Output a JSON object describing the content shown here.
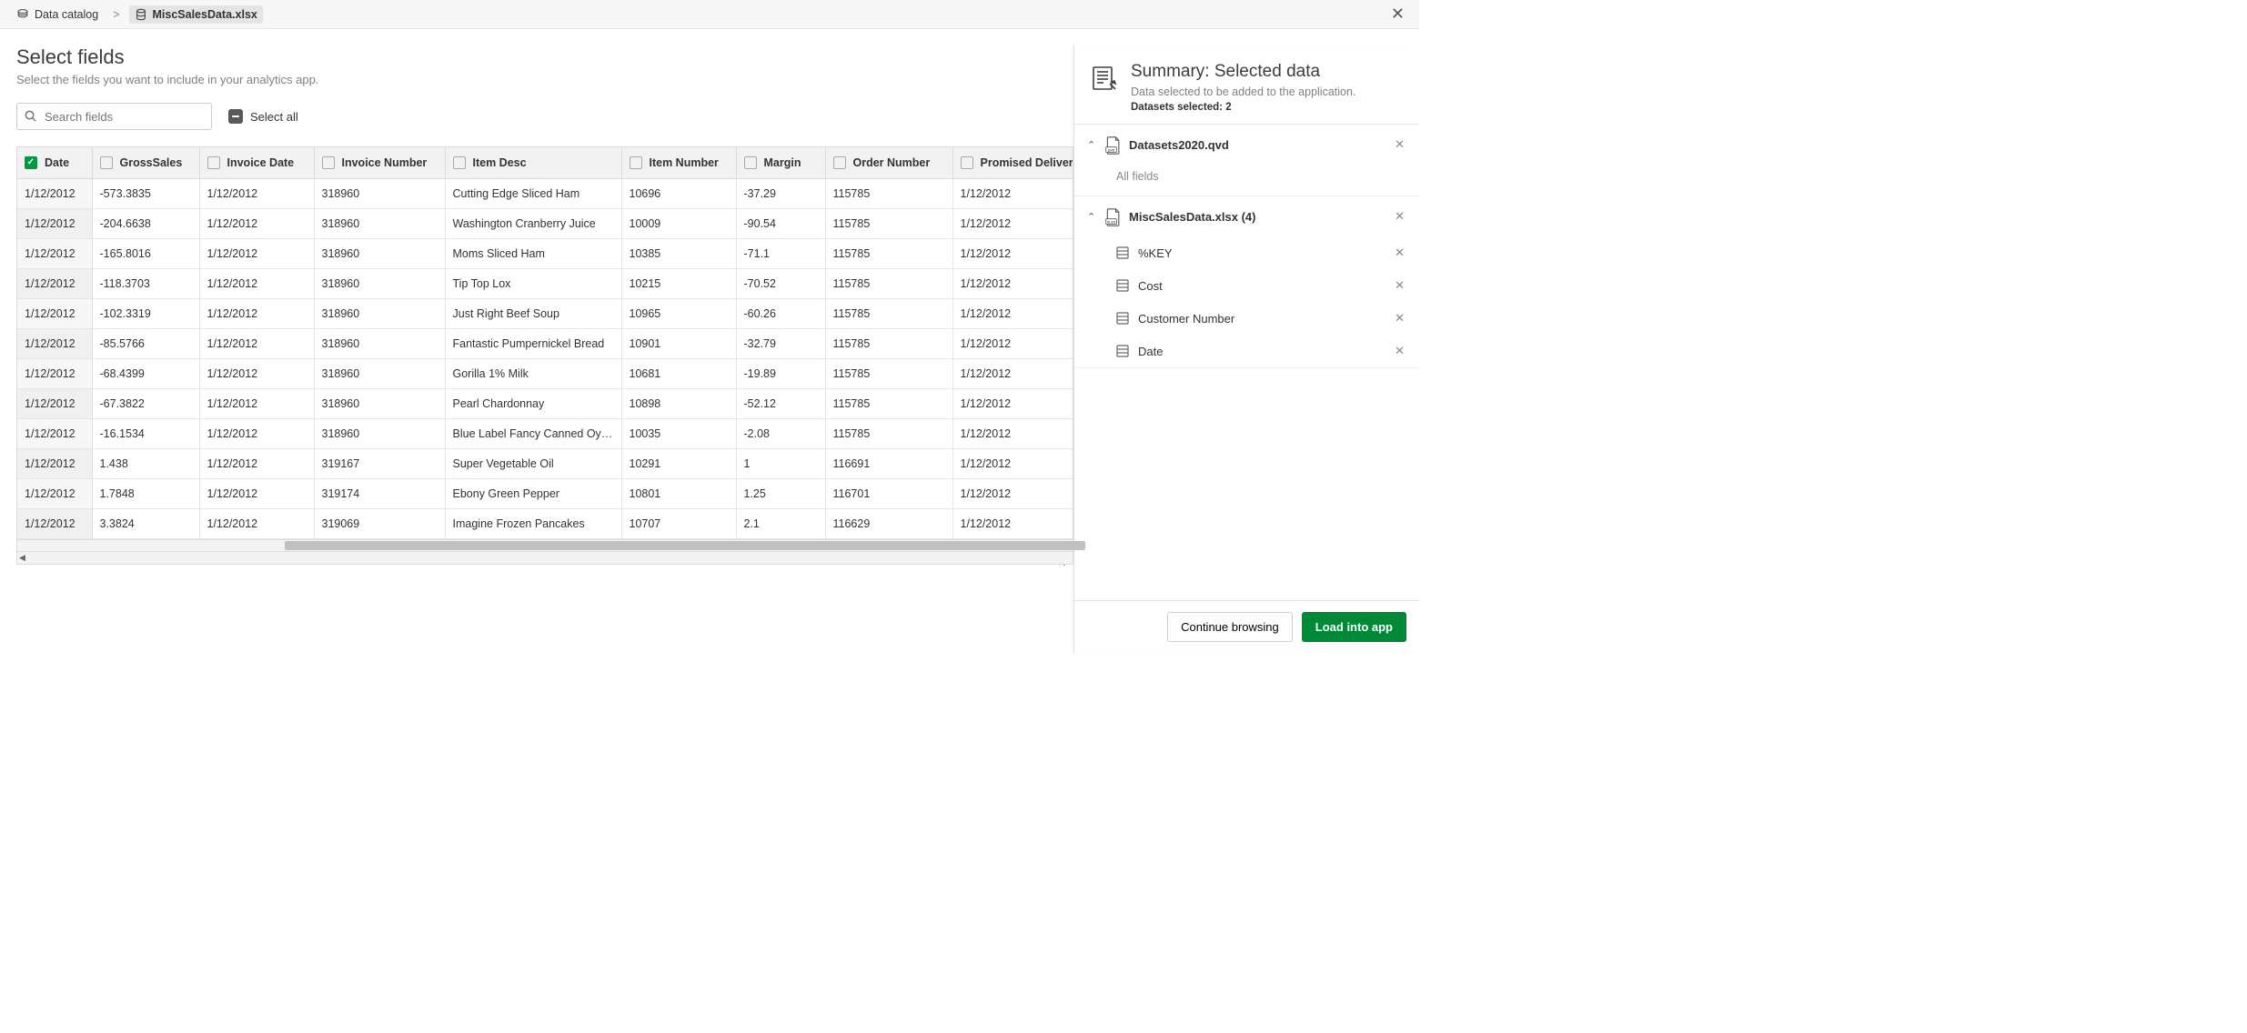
{
  "breadcrumb": {
    "root": "Data catalog",
    "current": "MiscSalesData.xlsx"
  },
  "heading": {
    "title": "Select fields",
    "subtitle": "Select the fields you want to include in your analytics app."
  },
  "search": {
    "placeholder": "Search fields"
  },
  "selectAll": "Select all",
  "columns": [
    {
      "label": "Date",
      "checked": true
    },
    {
      "label": "GrossSales",
      "checked": false
    },
    {
      "label": "Invoice Date",
      "checked": false
    },
    {
      "label": "Invoice Number",
      "checked": false
    },
    {
      "label": "Item Desc",
      "checked": false
    },
    {
      "label": "Item Number",
      "checked": false
    },
    {
      "label": "Margin",
      "checked": false
    },
    {
      "label": "Order Number",
      "checked": false
    },
    {
      "label": "Promised Delivery Date",
      "checked": false
    }
  ],
  "rows": [
    [
      "1/12/2012",
      "-573.3835",
      "1/12/2012",
      "318960",
      "Cutting Edge Sliced Ham",
      "10696",
      "-37.29",
      "115785",
      "1/12/2012"
    ],
    [
      "1/12/2012",
      "-204.6638",
      "1/12/2012",
      "318960",
      "Washington Cranberry Juice",
      "10009",
      "-90.54",
      "115785",
      "1/12/2012"
    ],
    [
      "1/12/2012",
      "-165.8016",
      "1/12/2012",
      "318960",
      "Moms Sliced Ham",
      "10385",
      "-71.1",
      "115785",
      "1/12/2012"
    ],
    [
      "1/12/2012",
      "-118.3703",
      "1/12/2012",
      "318960",
      "Tip Top Lox",
      "10215",
      "-70.52",
      "115785",
      "1/12/2012"
    ],
    [
      "1/12/2012",
      "-102.3319",
      "1/12/2012",
      "318960",
      "Just Right Beef Soup",
      "10965",
      "-60.26",
      "115785",
      "1/12/2012"
    ],
    [
      "1/12/2012",
      "-85.5766",
      "1/12/2012",
      "318960",
      "Fantastic Pumpernickel Bread",
      "10901",
      "-32.79",
      "115785",
      "1/12/2012"
    ],
    [
      "1/12/2012",
      "-68.4399",
      "1/12/2012",
      "318960",
      "Gorilla 1% Milk",
      "10681",
      "-19.89",
      "115785",
      "1/12/2012"
    ],
    [
      "1/12/2012",
      "-67.3822",
      "1/12/2012",
      "318960",
      "Pearl Chardonnay",
      "10898",
      "-52.12",
      "115785",
      "1/12/2012"
    ],
    [
      "1/12/2012",
      "-16.1534",
      "1/12/2012",
      "318960",
      "Blue Label Fancy Canned Oysters",
      "10035",
      "-2.08",
      "115785",
      "1/12/2012"
    ],
    [
      "1/12/2012",
      "1.438",
      "1/12/2012",
      "319167",
      "Super Vegetable Oil",
      "10291",
      "1",
      "116691",
      "1/12/2012"
    ],
    [
      "1/12/2012",
      "1.7848",
      "1/12/2012",
      "319174",
      "Ebony Green Pepper",
      "10801",
      "1.25",
      "116701",
      "1/12/2012"
    ],
    [
      "1/12/2012",
      "3.3824",
      "1/12/2012",
      "319069",
      "Imagine Frozen Pancakes",
      "10707",
      "2.1",
      "116629",
      "1/12/2012"
    ]
  ],
  "summary": {
    "title": "Summary: Selected data",
    "subtitle": "Data selected to be added to the application.",
    "countLabel": "Datasets selected: 2",
    "datasets": [
      {
        "name": "Datasets2020.qvd",
        "type": "qvd",
        "allFieldsLabel": "All fields",
        "fields": null
      },
      {
        "name": "MiscSalesData.xlsx (4)",
        "type": "xlsx",
        "allFieldsLabel": null,
        "fields": [
          "%KEY",
          "Cost",
          "Customer Number",
          "Date"
        ]
      }
    ]
  },
  "buttons": {
    "continue": "Continue browsing",
    "load": "Load into app"
  }
}
